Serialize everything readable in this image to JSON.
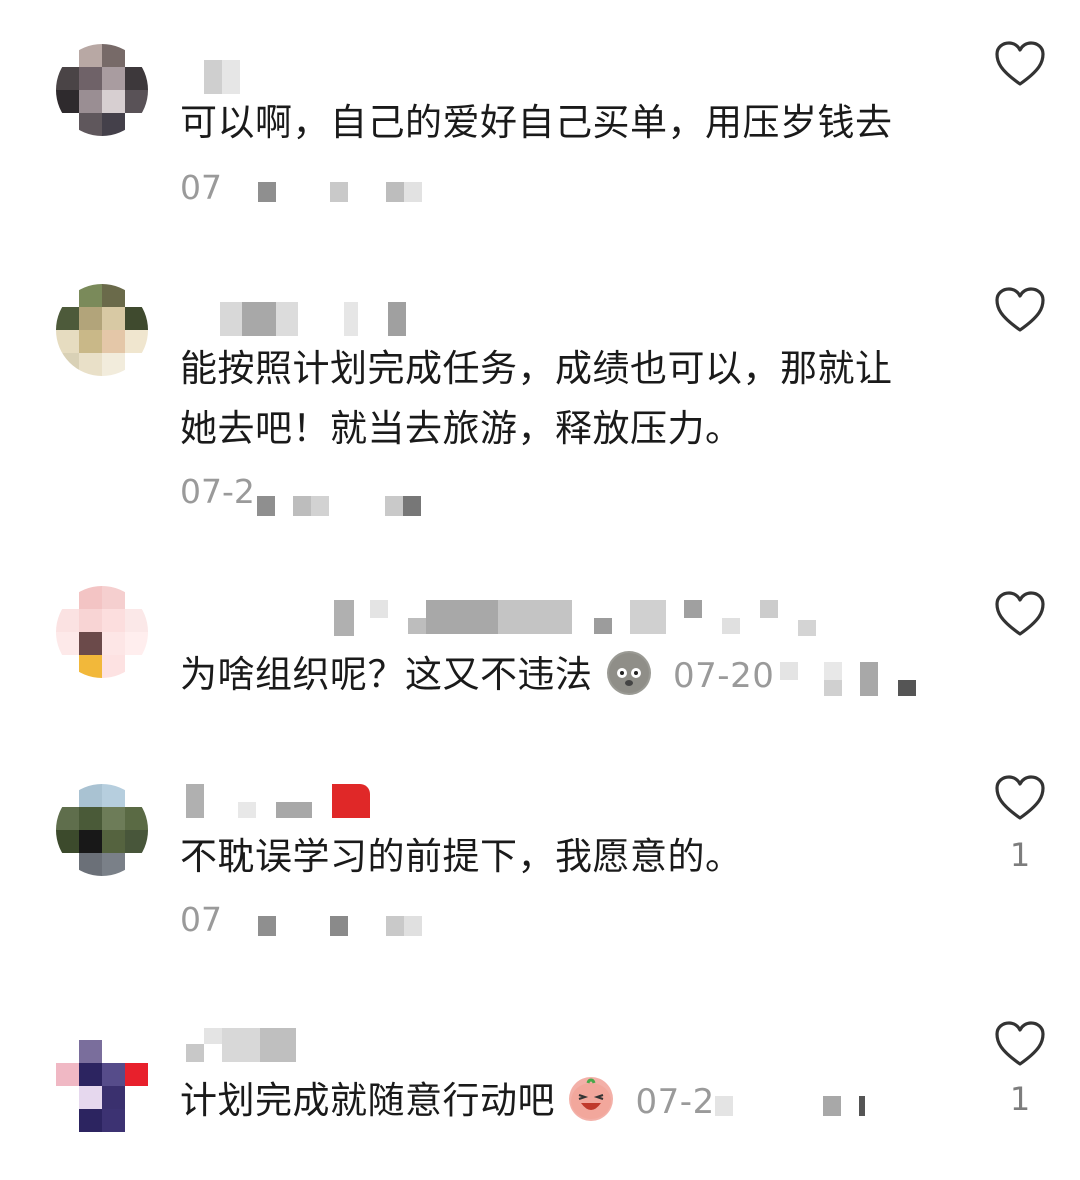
{
  "comments": [
    {
      "text": "可以啊，自己的爱好自己买单，用压岁钱去",
      "date": "07",
      "like_count": ""
    },
    {
      "text_line1": "能按照计划完成任务，成绩也可以，那就让",
      "text_line2": "她去吧！就当去旅游，释放压力。",
      "date": "07-2",
      "like_count": ""
    },
    {
      "text": "为啥组织呢？这又不违法",
      "date": "07-20",
      "emoji": "sweat-face-emoji",
      "like_count": ""
    },
    {
      "text": "不耽误学习的前提下，我愿意的。",
      "date": "07",
      "like_count": "1"
    },
    {
      "text": "计划完成就随意行动吧",
      "date": "07-2",
      "emoji": "laughing-face-emoji",
      "like_count": "1"
    }
  ],
  "icons": {
    "like": "heart-outline-icon"
  },
  "colors": {
    "text": "#1a1a1a",
    "meta": "#9a9a9a",
    "icon": "#333333"
  }
}
